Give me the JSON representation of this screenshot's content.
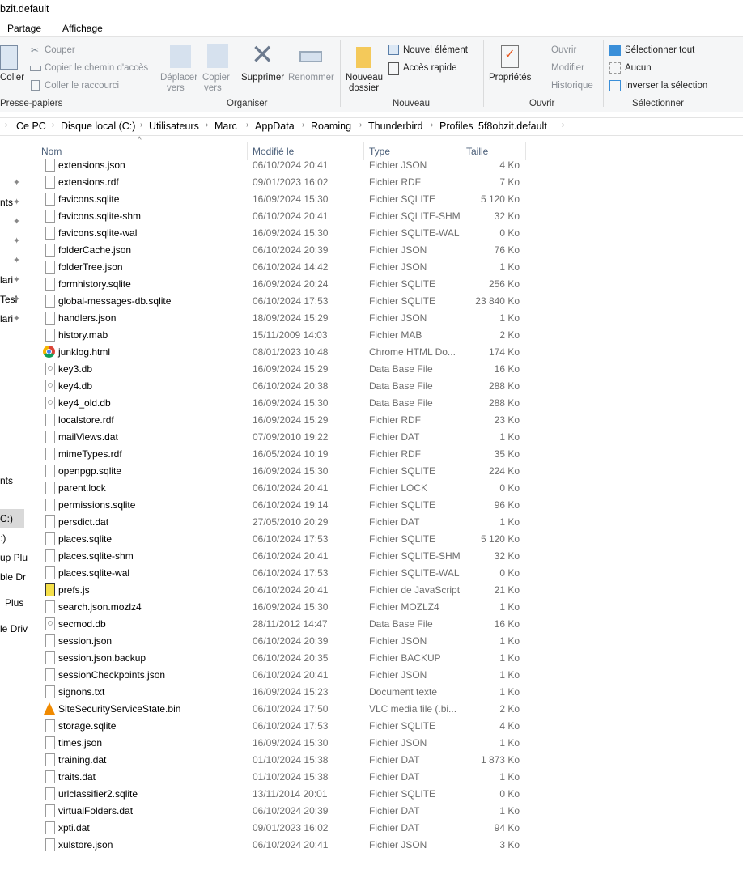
{
  "window": {
    "title": "bzit.default"
  },
  "ribbon_tabs": [
    "Partage",
    "Affichage"
  ],
  "ribbon": {
    "clipboard": {
      "paste": "Coller",
      "cut": "Couper",
      "copy_path": "Copier le chemin d'accès",
      "paste_shortcut": "Coller le raccourci",
      "group": "Presse-papiers"
    },
    "organize": {
      "move1": "Déplacer",
      "move2": "vers",
      "copy1": "Copier",
      "copy2": "vers",
      "delete": "Supprimer",
      "rename": "Renommer",
      "group": "Organiser"
    },
    "new": {
      "folder1": "Nouveau",
      "folder2": "dossier",
      "new_item": "Nouvel élément",
      "quick_access": "Accès rapide",
      "group": "Nouveau"
    },
    "open": {
      "properties": "Propriétés",
      "open": "Ouvrir",
      "edit": "Modifier",
      "history": "Historique",
      "group": "Ouvrir"
    },
    "select": {
      "all": "Sélectionner tout",
      "none": "Aucun",
      "invert": "Inverser la sélection",
      "group": "Sélectionner"
    }
  },
  "breadcrumb": [
    "Ce PC",
    "Disque local (C:)",
    "Utilisateurs",
    "Marc",
    "AppData",
    "Roaming",
    "Thunderbird",
    "Profiles",
    "5f8obzit.default"
  ],
  "nav_pane": [
    "nts",
    "lari",
    "Tesl",
    "lari",
    "nts",
    "C:)",
    ":)",
    "up Plu",
    "ble Dr",
    "Plus",
    "le Driv"
  ],
  "columns": {
    "name": "Nom",
    "modified": "Modifié le",
    "type": "Type",
    "size": "Taille"
  },
  "files": [
    [
      "extensions.json",
      "06/10/2024 20:41",
      "Fichier JSON",
      "4 Ko",
      "file"
    ],
    [
      "extensions.rdf",
      "09/01/2023 16:02",
      "Fichier RDF",
      "7 Ko",
      "file"
    ],
    [
      "favicons.sqlite",
      "16/09/2024 15:30",
      "Fichier SQLITE",
      "5 120 Ko",
      "file"
    ],
    [
      "favicons.sqlite-shm",
      "06/10/2024 20:41",
      "Fichier SQLITE-SHM",
      "32 Ko",
      "file"
    ],
    [
      "favicons.sqlite-wal",
      "16/09/2024 15:30",
      "Fichier SQLITE-WAL",
      "0 Ko",
      "file"
    ],
    [
      "folderCache.json",
      "06/10/2024 20:39",
      "Fichier JSON",
      "76 Ko",
      "file"
    ],
    [
      "folderTree.json",
      "06/10/2024 14:42",
      "Fichier JSON",
      "1 Ko",
      "file"
    ],
    [
      "formhistory.sqlite",
      "16/09/2024 20:24",
      "Fichier SQLITE",
      "256 Ko",
      "file"
    ],
    [
      "global-messages-db.sqlite",
      "06/10/2024 17:53",
      "Fichier SQLITE",
      "23 840 Ko",
      "file"
    ],
    [
      "handlers.json",
      "18/09/2024 15:29",
      "Fichier JSON",
      "1 Ko",
      "file"
    ],
    [
      "history.mab",
      "15/11/2009 14:03",
      "Fichier MAB",
      "2 Ko",
      "file"
    ],
    [
      "junklog.html",
      "08/01/2023 10:48",
      "Chrome HTML Do...",
      "174 Ko",
      "chrome"
    ],
    [
      "key3.db",
      "16/09/2024 15:29",
      "Data Base File",
      "16 Ko",
      "db"
    ],
    [
      "key4.db",
      "06/10/2024 20:38",
      "Data Base File",
      "288 Ko",
      "db"
    ],
    [
      "key4_old.db",
      "16/09/2024 15:30",
      "Data Base File",
      "288 Ko",
      "db"
    ],
    [
      "localstore.rdf",
      "16/09/2024 15:29",
      "Fichier RDF",
      "23 Ko",
      "file"
    ],
    [
      "mailViews.dat",
      "07/09/2010 19:22",
      "Fichier DAT",
      "1 Ko",
      "file"
    ],
    [
      "mimeTypes.rdf",
      "16/05/2024 10:19",
      "Fichier RDF",
      "35 Ko",
      "file"
    ],
    [
      "openpgp.sqlite",
      "16/09/2024 15:30",
      "Fichier SQLITE",
      "224 Ko",
      "file"
    ],
    [
      "parent.lock",
      "06/10/2024 20:41",
      "Fichier LOCK",
      "0 Ko",
      "file"
    ],
    [
      "permissions.sqlite",
      "06/10/2024 19:14",
      "Fichier SQLITE",
      "96 Ko",
      "file"
    ],
    [
      "persdict.dat",
      "27/05/2010 20:29",
      "Fichier DAT",
      "1 Ko",
      "file"
    ],
    [
      "places.sqlite",
      "06/10/2024 17:53",
      "Fichier SQLITE",
      "5 120 Ko",
      "file"
    ],
    [
      "places.sqlite-shm",
      "06/10/2024 20:41",
      "Fichier SQLITE-SHM",
      "32 Ko",
      "file"
    ],
    [
      "places.sqlite-wal",
      "06/10/2024 17:53",
      "Fichier SQLITE-WAL",
      "0 Ko",
      "file"
    ],
    [
      "prefs.js",
      "06/10/2024 20:41",
      "Fichier de JavaScript",
      "21 Ko",
      "js"
    ],
    [
      "search.json.mozlz4",
      "16/09/2024 15:30",
      "Fichier MOZLZ4",
      "1 Ko",
      "file"
    ],
    [
      "secmod.db",
      "28/11/2012 14:47",
      "Data Base File",
      "16 Ko",
      "db"
    ],
    [
      "session.json",
      "06/10/2024 20:39",
      "Fichier JSON",
      "1 Ko",
      "file"
    ],
    [
      "session.json.backup",
      "06/10/2024 20:35",
      "Fichier BACKUP",
      "1 Ko",
      "file"
    ],
    [
      "sessionCheckpoints.json",
      "06/10/2024 20:41",
      "Fichier JSON",
      "1 Ko",
      "file"
    ],
    [
      "signons.txt",
      "16/09/2024 15:23",
      "Document texte",
      "1 Ko",
      "file"
    ],
    [
      "SiteSecurityServiceState.bin",
      "06/10/2024 17:50",
      "VLC media file (.bi...",
      "2 Ko",
      "vlc"
    ],
    [
      "storage.sqlite",
      "06/10/2024 17:53",
      "Fichier SQLITE",
      "4 Ko",
      "file"
    ],
    [
      "times.json",
      "16/09/2024 15:30",
      "Fichier JSON",
      "1 Ko",
      "file"
    ],
    [
      "training.dat",
      "01/10/2024 15:38",
      "Fichier DAT",
      "1 873 Ko",
      "file"
    ],
    [
      "traits.dat",
      "01/10/2024 15:38",
      "Fichier DAT",
      "1 Ko",
      "file"
    ],
    [
      "urlclassifier2.sqlite",
      "13/11/2014 20:01",
      "Fichier SQLITE",
      "0 Ko",
      "file"
    ],
    [
      "virtualFolders.dat",
      "06/10/2024 20:39",
      "Fichier DAT",
      "1 Ko",
      "file"
    ],
    [
      "xpti.dat",
      "09/01/2023 16:02",
      "Fichier DAT",
      "94 Ko",
      "file"
    ],
    [
      "xulstore.json",
      "06/10/2024 20:41",
      "Fichier JSON",
      "3 Ko",
      "file"
    ]
  ]
}
